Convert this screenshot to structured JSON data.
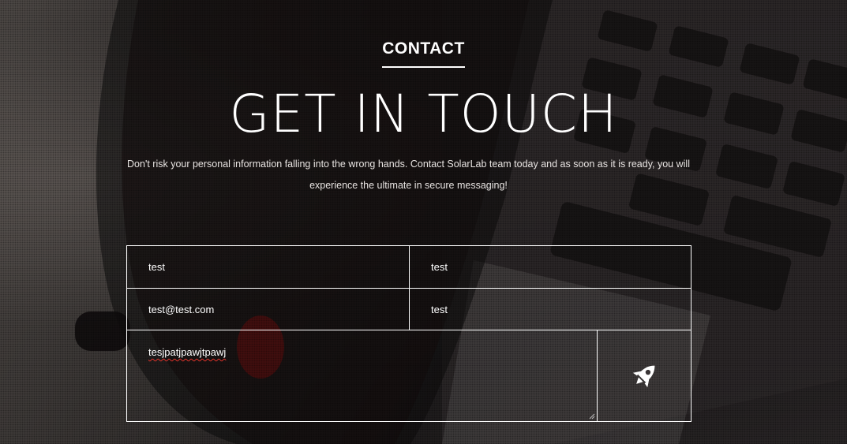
{
  "section": {
    "eyebrow": "CONTACT",
    "title": "GET IN TOUCH",
    "description": "Don't risk your personal information falling into the wrong hands. Contact SolarLab team today and as soon as it is ready, you will experience the ultimate in secure messaging!"
  },
  "form": {
    "field1_value": "test",
    "field2_value": "test",
    "email_value": "test@test.com",
    "field4_value": "test",
    "message_value": "tesjpatjpawjtpawj",
    "submit_icon": "rocket-icon"
  },
  "colors": {
    "text": "#ffffff",
    "border": "#ffffff",
    "spellcheck": "#e0322a"
  }
}
